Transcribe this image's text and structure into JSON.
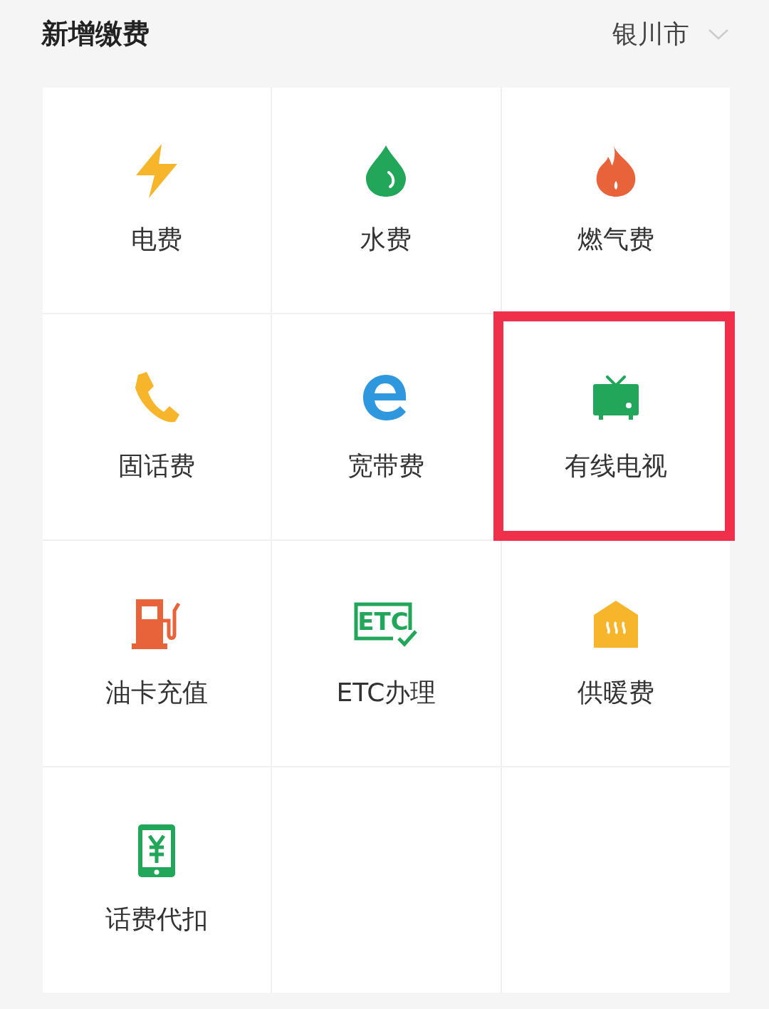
{
  "header": {
    "title": "新增缴费",
    "city": "银川市"
  },
  "items": [
    {
      "kind": "service",
      "label": "电费",
      "highlighted": false
    },
    {
      "kind": "service",
      "label": "水费",
      "highlighted": false
    },
    {
      "kind": "service",
      "label": "燃气费",
      "highlighted": false
    },
    {
      "kind": "service",
      "label": "固话费",
      "highlighted": false
    },
    {
      "kind": "service",
      "label": "宽带费",
      "highlighted": false
    },
    {
      "kind": "service",
      "label": "有线电视",
      "highlighted": true
    },
    {
      "kind": "service",
      "label": "油卡充值",
      "highlighted": false
    },
    {
      "kind": "service",
      "label": "ETC办理",
      "highlighted": false,
      "icon_text": "ETC"
    },
    {
      "kind": "service",
      "label": "供暖费",
      "highlighted": false
    },
    {
      "kind": "service",
      "label": "话费代扣",
      "highlighted": false
    },
    {
      "kind": "empty"
    },
    {
      "kind": "empty"
    }
  ]
}
